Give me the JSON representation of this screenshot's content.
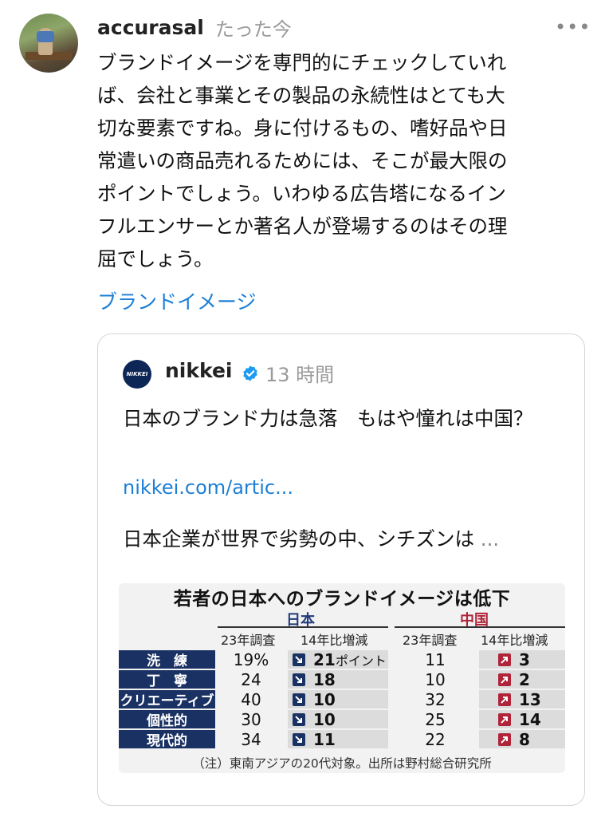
{
  "post": {
    "username": "accurasal",
    "timestamp": "たった今",
    "more_icon": "•••",
    "text_lines": [
      "ブランドイメージを専門的にチェックしていれ",
      "ば、会社と事業とその製品の永続性はとても大",
      "切な要素ですね。身に付けるもの、嗜好品や日",
      "常遣いの商品売れるためには、そこが最大限の",
      "ポイントでしょう。いわゆる広告塔になるイン",
      "フルエンサーとか著名人が登場するのはその理",
      "屈でしょう。"
    ],
    "tag": "ブランドイメージ"
  },
  "quote": {
    "logo_text": "NIKKEI",
    "name": "nikkei",
    "time": "13 時間",
    "headline": "日本のブランド力は急落　もはや憧れは中国？",
    "link": "nikkei.com/artic...",
    "summary": "日本企業が世界で劣勢の中、シチズンは",
    "summary_ellipsis": "..."
  },
  "infographic": {
    "title": "若者の日本へのブランドイメージは低下",
    "regions": [
      "日本",
      "中国"
    ],
    "subheaders": [
      "23年調査",
      "14年比増減",
      "23年調査",
      "14年比増減"
    ],
    "unit": "ポイント",
    "rows": [
      {
        "label": "洗　練",
        "jp": "19%",
        "jp_chg": "21",
        "cn": "11",
        "cn_chg": "3"
      },
      {
        "label": "丁　寧",
        "jp": "24",
        "jp_chg": "18",
        "cn": "10",
        "cn_chg": "2"
      },
      {
        "label": "クリエーティブ",
        "jp": "40",
        "jp_chg": "10",
        "cn": "32",
        "cn_chg": "13"
      },
      {
        "label": "個性的",
        "jp": "30",
        "jp_chg": "10",
        "cn": "25",
        "cn_chg": "14"
      },
      {
        "label": "現代的",
        "jp": "34",
        "jp_chg": "11",
        "cn": "22",
        "cn_chg": "8"
      }
    ],
    "note": "（注）東南アジアの20代対象。出所は野村総合研究所"
  },
  "colors": {
    "link": "#1d7fd6",
    "jp_accent": "#1a3163",
    "cn_accent": "#b0243a",
    "verified": "#1d9bf0"
  }
}
